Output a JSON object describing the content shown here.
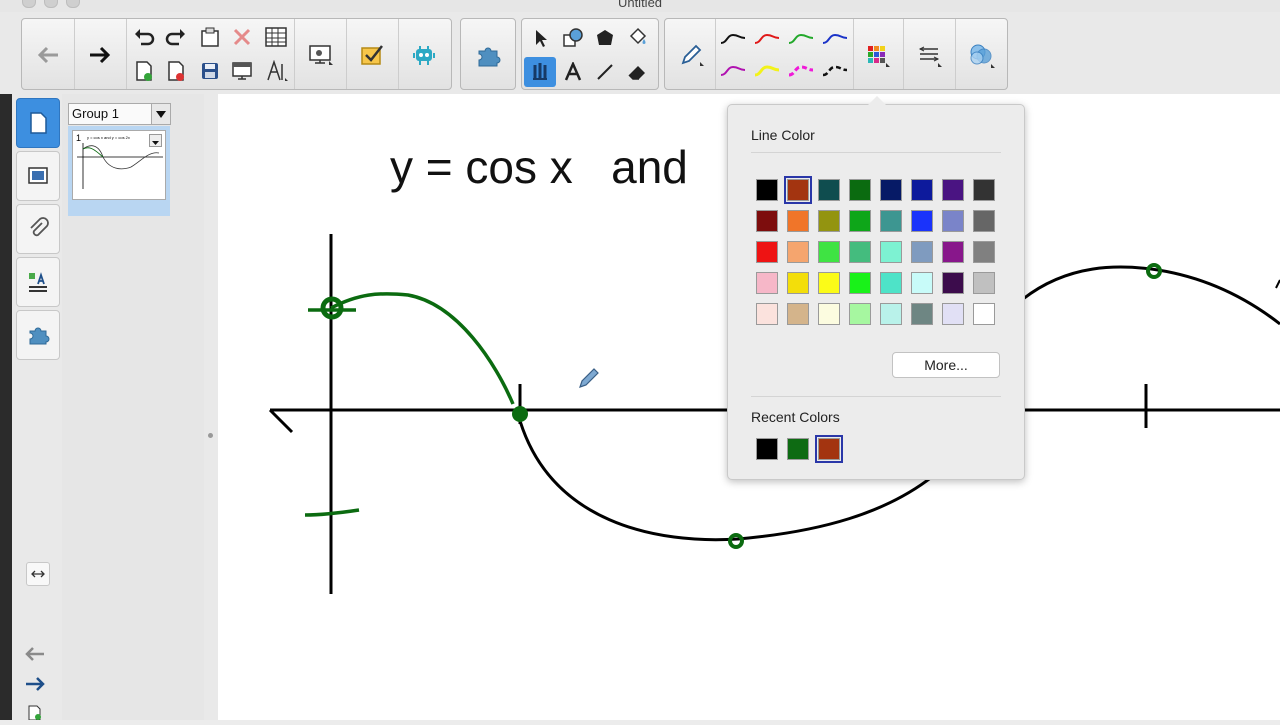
{
  "window": {
    "title": "Untitled"
  },
  "sorter": {
    "group_label": "Group 1",
    "page_number": "1",
    "thumb_title": "y = cos x  and y = cos 2x"
  },
  "canvas": {
    "heading": "y = cos x   and"
  },
  "line_color_popup": {
    "title": "Line Color",
    "more_label": "More...",
    "recent_title": "Recent Colors",
    "selected_color": "#a33410",
    "palette": [
      [
        "#000000",
        "#a33410",
        "#0f4d4f",
        "#0b6b10",
        "#061a66",
        "#0d1a9c",
        "#4a1482",
        "#333333"
      ],
      [
        "#7d0d0d",
        "#f07529",
        "#939410",
        "#0ea619",
        "#3d9691",
        "#1a33fb",
        "#7a84c9",
        "#666666"
      ],
      [
        "#ee1313",
        "#f5a56e",
        "#3fe343",
        "#44bc7e",
        "#7df2d2",
        "#7f9bbf",
        "#88178b",
        "#808080"
      ],
      [
        "#f6b7c8",
        "#f3de0a",
        "#fbfb18",
        "#19f219",
        "#4ee3c8",
        "#c8fbf9",
        "#3c0c4c",
        "#c0c0c0"
      ],
      [
        "#fbe2dd",
        "#d4b48b",
        "#fcfce0",
        "#a6f7a0",
        "#b9f2ea",
        "#6e8683",
        "#e1e0f5",
        "#ffffff"
      ]
    ],
    "recent_colors": [
      "#000000",
      "#0e6b13",
      "#a33410"
    ]
  },
  "colors": {
    "accent": "#3d8fe0",
    "ink_black": "#000000",
    "ink_green": "#0b6b10"
  }
}
